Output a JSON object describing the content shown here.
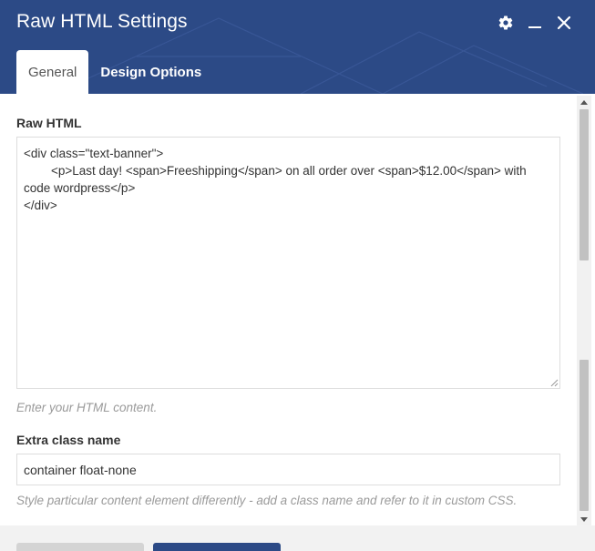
{
  "window": {
    "title": "Raw HTML Settings",
    "controls": [
      {
        "name": "gear-icon"
      },
      {
        "name": "minimize-icon"
      },
      {
        "name": "close-icon"
      }
    ]
  },
  "tabs": [
    {
      "label": "General",
      "active": true
    },
    {
      "label": "Design Options",
      "active": false
    }
  ],
  "form": {
    "raw_html": {
      "label": "Raw HTML",
      "value": "<div class=\"text-banner\">\n\t<p>Last day! <span>Freeshipping</span> on all order over <span>$12.00</span> with code wordpress</p>\n</div>",
      "help": "Enter your HTML content."
    },
    "extra_class": {
      "label": "Extra class name",
      "value": "container float-none",
      "help": "Style particular content element differently - add a class name and refer to it in custom CSS."
    }
  },
  "footer": {
    "buttons": [
      {
        "name": "close-button"
      },
      {
        "name": "save-button"
      }
    ]
  },
  "colors": {
    "header_bg": "#2c4a86",
    "label_text": "#333333",
    "help_text": "#9a9a9a",
    "border": "#dddddd"
  }
}
